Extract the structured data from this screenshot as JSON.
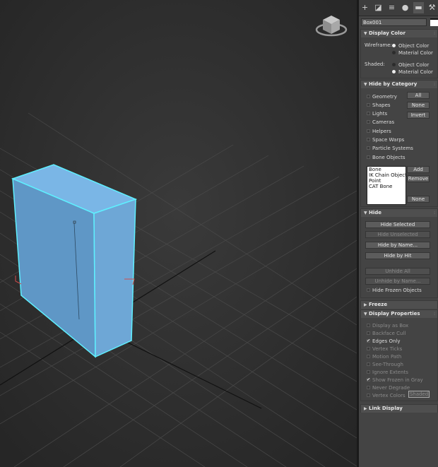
{
  "panel": {
    "tabs": [
      {
        "icon": "create-icon",
        "glyph": "+"
      },
      {
        "icon": "modify-icon",
        "glyph": "◪"
      },
      {
        "icon": "hierarchy-icon",
        "glyph": "≡"
      },
      {
        "icon": "motion-icon",
        "glyph": "●"
      },
      {
        "icon": "display-icon",
        "glyph": "▬"
      },
      {
        "icon": "utilities-icon",
        "glyph": "⚒"
      }
    ],
    "object_name": "Box001",
    "object_color": "#ffffff",
    "display_color": {
      "title": "Display Color",
      "wireframe_label": "Wireframe:",
      "wireframe_options": [
        "Object Color",
        "Material Color"
      ],
      "wireframe_selected": "Object Color",
      "shaded_label": "Shaded:",
      "shaded_options": [
        "Object Color",
        "Material Color"
      ],
      "shaded_selected": "Material Color"
    },
    "hide_by_category": {
      "title": "Hide by Category",
      "categories": [
        "Geometry",
        "Shapes",
        "Lights",
        "Cameras",
        "Helpers",
        "Space Warps",
        "Particle Systems",
        "Bone Objects"
      ],
      "buttons": {
        "all": "All",
        "none": "None",
        "invert": "Invert",
        "add": "Add",
        "remove": "Remove",
        "none2": "None"
      },
      "list_items": [
        "Bone",
        "IK Chain Object",
        "Point",
        "CAT Bone"
      ]
    },
    "hide": {
      "title": "Hide",
      "hide_selected": "Hide Selected",
      "hide_unselected": "Hide Unselected",
      "hide_by_name": "Hide by Name...",
      "hide_by_hit": "Hide by Hit",
      "unhide_all": "Unhide All",
      "unhide_by_name": "Unhide by Name...",
      "hide_frozen": "Hide Frozen Objects"
    },
    "freeze": {
      "title": "Freeze"
    },
    "display_properties": {
      "title": "Display Properties",
      "items": [
        {
          "label": "Display as Box",
          "checked": false
        },
        {
          "label": "Backface Cull",
          "checked": false
        },
        {
          "label": "Edges Only",
          "checked": true
        },
        {
          "label": "Vertex Ticks",
          "checked": false
        },
        {
          "label": "Motion Path",
          "checked": false
        },
        {
          "label": "See-Through",
          "checked": false
        },
        {
          "label": "Ignore Extents",
          "checked": false
        },
        {
          "label": "Show Frozen in Gray",
          "checked": true
        },
        {
          "label": "Never Degrade",
          "checked": false
        },
        {
          "label": "Vertex Colors",
          "checked": false
        }
      ],
      "shaded_button": "Shaded"
    },
    "link_display": {
      "title": "Link Display"
    }
  },
  "viewport": {
    "box_color": "#6aa3d4",
    "selection_color": "#5ef0ff"
  }
}
